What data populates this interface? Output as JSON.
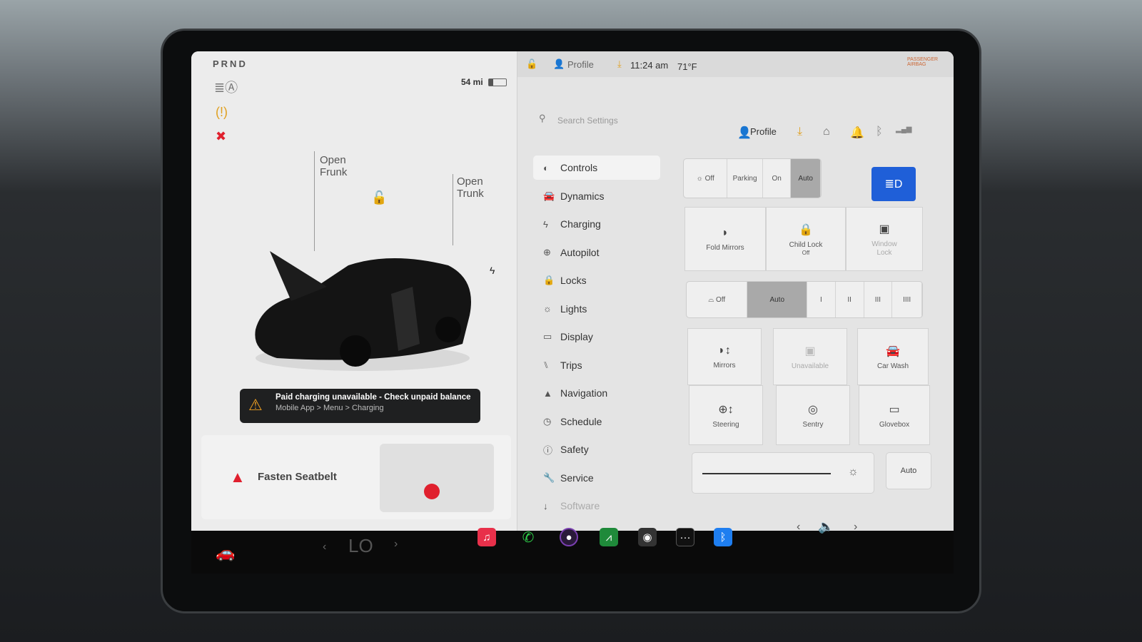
{
  "status": {
    "gear": "PRND",
    "range": "54 mi",
    "battery_level": 0.25
  },
  "left": {
    "open_frunk": [
      "Open",
      "Frunk"
    ],
    "open_trunk": [
      "Open",
      "Trunk"
    ],
    "alert": {
      "title": "Paid charging unavailable - Check unpaid balance",
      "subtitle": "Mobile App > Menu > Charging"
    },
    "seatbelt": "Fasten Seatbelt"
  },
  "topbar": {
    "profile": "Profile",
    "time": "11:24 am",
    "temp": "71°F",
    "airbag": "PASSENGER AIRBAG"
  },
  "settings": {
    "search_placeholder": "Search Settings",
    "profile": "Profile",
    "nav": [
      {
        "label": "Controls",
        "icon": "toggle-icon"
      },
      {
        "label": "Dynamics",
        "icon": "car-icon"
      },
      {
        "label": "Charging",
        "icon": "bolt-icon"
      },
      {
        "label": "Autopilot",
        "icon": "steering-wheel-icon"
      },
      {
        "label": "Locks",
        "icon": "lock-icon"
      },
      {
        "label": "Lights",
        "icon": "sun-icon"
      },
      {
        "label": "Display",
        "icon": "display-icon"
      },
      {
        "label": "Trips",
        "icon": "trips-icon"
      },
      {
        "label": "Navigation",
        "icon": "navigation-icon"
      },
      {
        "label": "Schedule",
        "icon": "clock-icon"
      },
      {
        "label": "Safety",
        "icon": "info-icon"
      },
      {
        "label": "Service",
        "icon": "wrench-icon"
      },
      {
        "label": "Software",
        "icon": "download-icon"
      }
    ],
    "active_nav": "Controls",
    "lights": {
      "options": [
        "Off",
        "Parking",
        "On",
        "Auto"
      ],
      "selected": "Auto"
    },
    "tiles_row1": [
      {
        "label": "Fold Mirrors"
      },
      {
        "label": "Child Lock",
        "sub": "Off"
      },
      {
        "label": "Window",
        "sub": "Lock"
      }
    ],
    "wipers": {
      "options": [
        "Off",
        "Auto",
        "I",
        "II",
        "III",
        "IIII"
      ],
      "selected": "Auto"
    },
    "tiles_grid": [
      {
        "label": "Mirrors"
      },
      {
        "label": "Unavailable"
      },
      {
        "label": "Car Wash"
      },
      {
        "label": "Steering"
      },
      {
        "label": "Sentry"
      },
      {
        "label": "Glovebox"
      }
    ],
    "brightness_level": 0.92,
    "brightness_auto": "Auto"
  },
  "taskbar": {
    "climate": "LO",
    "apps": [
      "music-icon",
      "phone-icon",
      "camera-icon",
      "stocks-icon",
      "dashcam-icon",
      "more-icon",
      "bluetooth-icon"
    ]
  },
  "colors": {
    "accent": "#1f5fd8",
    "warning": "#f0a020",
    "danger": "#e0202e"
  }
}
